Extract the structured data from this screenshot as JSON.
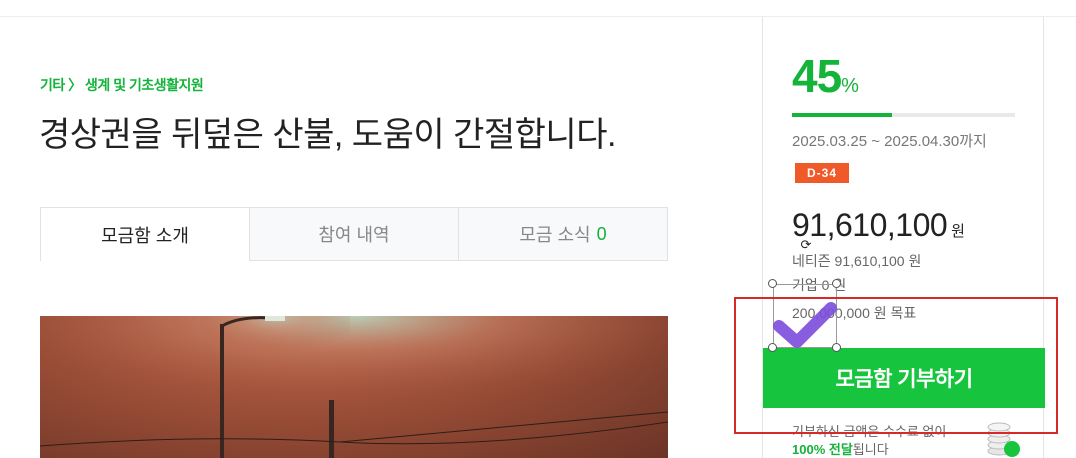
{
  "campaign": {
    "category": "기타 〉 생계 및 기초생활지원",
    "title": "경상권을 뒤덮은 산불, 도움이 간절합니다."
  },
  "tabs": [
    {
      "label": "모금함 소개",
      "active": true
    },
    {
      "label": "참여 내역",
      "active": false
    },
    {
      "label": "모금 소식",
      "count": "0",
      "active": false
    }
  ],
  "sidebar": {
    "percent": "45",
    "percent_sign": "%",
    "progress_fraction": 0.45,
    "period_dates": "2025.03.25 ~ 2025.04.30",
    "period_suffix": "까지",
    "dday": "D-34",
    "total_amount": "91,610,100",
    "amount_unit": "원",
    "netizen_line": "네티즌 91,610,100 원",
    "company_line": "기업 0 원",
    "goal_line": "200,000,000 원 목표",
    "donate_button": "모금함 기부하기",
    "fee_note_line1": "기부하신 금액은 수수료 없이",
    "fee_note_highlight": "100% 전달",
    "fee_note_end": "됩니다"
  },
  "overlay": {
    "rotate_symbol": "⟳"
  },
  "colors": {
    "accent_green": "#14b33a",
    "button_green": "#16c43d",
    "dday_orange": "#f05a28",
    "highlight_red": "#d62a2a",
    "checkmark_purple": "#7b4bdb"
  }
}
